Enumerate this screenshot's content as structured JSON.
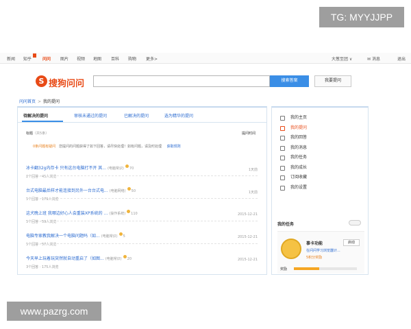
{
  "watermarks": {
    "top": "TG: MYYJJPP",
    "bottom": "www.pazrg.com"
  },
  "topnav": {
    "items": [
      "新闻",
      "知乎",
      "问问",
      "图片",
      "视频",
      "地图",
      "百科",
      "购物",
      "更多>"
    ],
    "active": "问问",
    "right": [
      "大葱至团 ∨",
      "消息",
      "退出"
    ]
  },
  "logo": {
    "mark": "S",
    "text": "搜狗问问"
  },
  "search": {
    "value": "",
    "search_button": "搜索答案",
    "ask_button": "我要提问"
  },
  "breadcrumb": {
    "home": "问问首页",
    "separator": ">",
    "current": "我的提问"
  },
  "tabs": [
    "待解决的提问",
    "审核未通过的提问",
    "已解决的提问",
    "选为精华的提问"
  ],
  "list": {
    "head_label": "标题",
    "head_count": "（共5条）",
    "time_col": "提问时间",
    "notice_warn": "0条问题有疑问",
    "notice_text": "您提问的问题获得了如下回答，请尽快处理！如有问题，请及时处理",
    "notice_link": "获取规则"
  },
  "questions": [
    {
      "title": "冰卡翻32g内存卡 只有这台电脑打不开 其...",
      "cat": "(电脑常识)",
      "reward": "70",
      "meta": "2个回答 · 45人浏览",
      "date": "1天前"
    },
    {
      "title": "台式电脑最后样才能连接到另外一台台式电...",
      "cat": "(电脑网络)",
      "reward": "50",
      "meta": "5个回答 · 179人浏览",
      "date": "1天前"
    },
    {
      "title": "这犬晚上班 我哪边好心人会重装XP系统的 ...",
      "cat": "(操作系统)",
      "reward": "110",
      "meta": "5个回答 · 59人浏览",
      "date": "2015-12-21"
    },
    {
      "title": "电脑专家教我解决一个电脑问题吗（如...",
      "cat": "(电脑常识)",
      "reward": "5",
      "meta": "5个回答 · 57人浏览",
      "date": "2015-12-21"
    },
    {
      "title": "今天早上玩着玩突然就自动重启了（如图...",
      "cat": "(电脑常识)",
      "reward": "20",
      "meta": "3个回答 · 175人浏览",
      "date": "2015-12-21"
    }
  ],
  "sidebar": {
    "menu": [
      "我的主页",
      "我的提问",
      "我的回答",
      "我的消息",
      "我的任务",
      "我的成长",
      "订阅收藏",
      "我的设置"
    ],
    "active": "我的提问",
    "tasks_title": "我的任务",
    "task": {
      "name": "事卡功能",
      "start": "启动",
      "desc": "在问问学习浏览器计...",
      "reward": "5积分奖励",
      "bottom_label": "奖励",
      "progress": 0.4
    }
  }
}
